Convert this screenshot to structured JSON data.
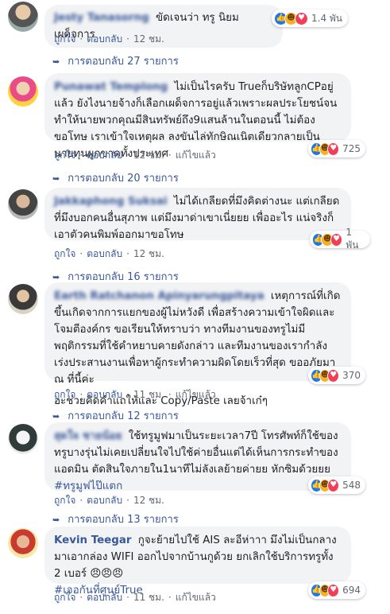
{
  "comments": [
    {
      "author": "Jesty Tanasorng",
      "text": "ขัดเจนว่า ทรู นิยมเผด็จการ",
      "reactions": "1.4 พัน",
      "actions": {
        "like": "ถูกใจ",
        "reply": "ตอบกลับ",
        "time": "12 ชม."
      },
      "replies": "การตอบกลับ 27 รายการ"
    },
    {
      "author": "Punawat Templong",
      "text": "ไม่เป็นไรครับ Trueก็บริษัทลูกCPอยู่แล้ว ยังไงนายจ้างก็เลือกเผด็จการอยู่แล้วเพราะผลประโยชน์จนทำให้นายพวกคุณมีสินทรัพย์ถึง9แสนล้านในตอนนี้ ไม่ต้องขอโทษ เราเข้าใจเหตุผล ลงขันไล่ทักษิณเนิตเดียวกลายเป็นนายทุนผูกขาดทั้งประเทศ",
      "reactions": "725",
      "actions": {
        "like": "ถูกใจ",
        "reply": "ตอบกลับ",
        "time": "12 ชม.",
        "edited": "แก้ไขแล้ว"
      },
      "replies": "การตอบกลับ 20 รายการ"
    },
    {
      "author": "Jakkaphong Suksai",
      "text": "ไม่ได้เกลียดที่มึงคิดต่างนะ แต่เกลียดที่มึงบอกคนอื่นสุภาพ แต่มึงมาด่าเขาเนี่ยยย เพื่ออะไร แน่จริงก็เอาตัวคนพิมพ์ออกมาขอโทษ",
      "reactions": "1 พัน",
      "actions": {
        "like": "ถูกใจ",
        "reply": "ตอบกลับ",
        "time": "12 ชม."
      },
      "replies": "การตอบกลับ 16 รายการ"
    },
    {
      "author": "Earth Ratchanon Apinyarungpitaya",
      "text": "เหตุการณ์ที่เกิดขึ้นเกิดจากการแยกของผู้ไม่หวังดี เพื่อสร้างความเข้าใจผิดและโจมตีองค์กร ขอเรียนให้ทราบว่า ทางทีมงานของทรูไม่มีพฤติกรรมที่ใช้คำหยาบคายดังกล่าว และทีมงานของเรากำลังเร่งประสานงานเพื่อหาผู้กระทำความผิดโดยเร็วที่สุด ขออภัยมา ณ ที่นี้ค่ะ",
      "extra": "อะช่วยคิดคำแถให้และ Copy/Paste เลยจ้าเก๋ๆ",
      "reactions": "370",
      "actions": {
        "like": "ถูกใจ",
        "reply": "ตอบกลับ",
        "time": "11 ชม.",
        "edited": "แก้ไขแล้ว"
      },
      "replies": "การตอบกลับ 12 รายการ"
    },
    {
      "author": "สุดใจ ชายน้อย",
      "text": "ใช้ทรูมูฟมาเป็นระยะเวลา7ปี โทรศัพท์ก็ใช้ของทรูบางรุ่นไม่เคยเปลี่ยนใจไปใช้ค่ายอื่นแต่ได้เห็นการกระทำของแอดมิน ตัดสินใจภายใน1นาทีไม่ลังเลย้ายค่ายย หักซิมด้วยยย",
      "hashtag": "#ทรูมูฟไป๊แตก",
      "reactions": "548",
      "actions": {
        "like": "ถูกใจ",
        "reply": "ตอบกลับ",
        "time": "12 ชม."
      },
      "replies": "การตอบกลับ 13 รายการ"
    },
    {
      "author": "Kevin Teegar",
      "text": "กูจะย้ายไปใช้ AIS ละอีห่าาา มึงไม่เป็นกลาง มาเอากล่อง WIFI ออกไปจากบ้านกูด้วย ยกเลิกใช้บริการทรูทั้ง 2 เบอร์ 😠😠😠",
      "hashtag": "#เจอกันที่ศูนย์True",
      "reactions": "694",
      "actions": {
        "like": "ถูกใจ",
        "reply": "ตอบกลับ",
        "time": "11 ชม.",
        "edited": "แก้ไขแล้ว"
      }
    }
  ],
  "reaction_icons": [
    "like-icon",
    "haha-icon",
    "love-icon"
  ],
  "colors": {
    "link": "#385898",
    "bubble": "#f2f3f5",
    "meta": "#606770",
    "like": "#1877f2",
    "love": "#f33e58",
    "haha": "#f7b125"
  }
}
